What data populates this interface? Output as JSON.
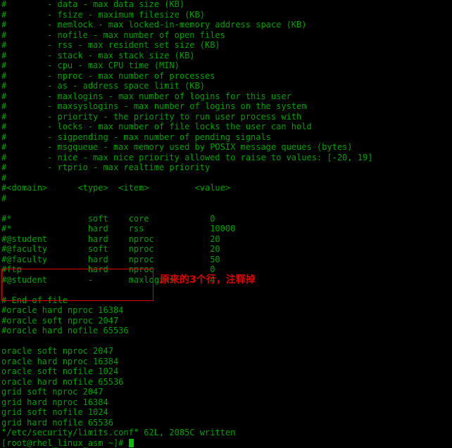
{
  "terminal": {
    "colors": {
      "background": "#000000",
      "foreground": "#00a000",
      "annotation": "#e00000",
      "cursor": "#00c000"
    },
    "lines": [
      "#        - data - max data size (KB)",
      "#        - fsize - maximum filesize (KB)",
      "#        - memlock - max locked-in-memory address space (KB)",
      "#        - nofile - max number of open files",
      "#        - rss - max resident set size (KB)",
      "#        - stack - max stack size (KB)",
      "#        - cpu - max CPU time (MIN)",
      "#        - nproc - max number of processes",
      "#        - as - address space limit (KB)",
      "#        - maxlogins - max number of logins for this user",
      "#        - maxsyslogins - max number of logins on the system",
      "#        - priority - the priority to run user process with",
      "#        - locks - max number of file locks the user can hold",
      "#        - sigpending - max number of pending signals",
      "#        - msgqueue - max memory used by POSIX message queues (bytes)",
      "#        - nice - max nice priority allowed to raise to values: [-20, 19]",
      "#        - rtprio - max realtime priority",
      "#",
      "#<domain>      <type>  <item>         <value>",
      "#",
      "",
      "#*               soft    core            0",
      "#*               hard    rss             10000",
      "#@student        hard    nproc           20",
      "#@faculty        soft    nproc           20",
      "#@faculty        hard    nproc           50",
      "#ftp             hard    nproc           0",
      "#@student        -       maxlogins       4",
      "",
      "# End of file",
      "#oracle hard nproc 16384",
      "#oracle soft nproc 2047",
      "#oracle hard nofile 65536",
      "",
      "oracle soft nproc 2047",
      "oracle hard nproc 16384",
      "oracle soft nofile 1024",
      "oracle hard nofile 65536",
      "grid soft nproc 2047",
      "grid hard nproc 16384",
      "grid soft nofile 1024",
      "grid hard nofile 65536",
      "\"/etc/security/limits.conf\" 62L, 2085C written"
    ],
    "prompt": "[root@rhel_linux_asm ~]# ",
    "annotation": {
      "text": "原来的3个行，注释掉"
    }
  }
}
